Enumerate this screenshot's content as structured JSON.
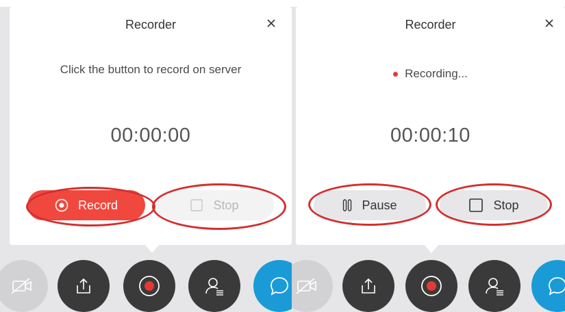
{
  "left": {
    "title": "Recorder",
    "status": "Click the button to record on server",
    "timer": "00:00:00",
    "record_label": "Record",
    "stop_label": "Stop"
  },
  "right": {
    "title": "Recorder",
    "status": "Recording...",
    "timer": "00:00:10",
    "pause_label": "Pause",
    "stop_label": "Stop"
  },
  "toolbar": [
    "video-off-icon",
    "share-screen-icon",
    "record-icon",
    "participants-icon",
    "chat-icon"
  ],
  "colors": {
    "record_red": "#f0483e",
    "annotation_red": "#d32f2f",
    "toolbar_dark": "#3a3a3a",
    "chat_blue": "#1a9bd8",
    "panel_bg": "#e6e6e8"
  }
}
